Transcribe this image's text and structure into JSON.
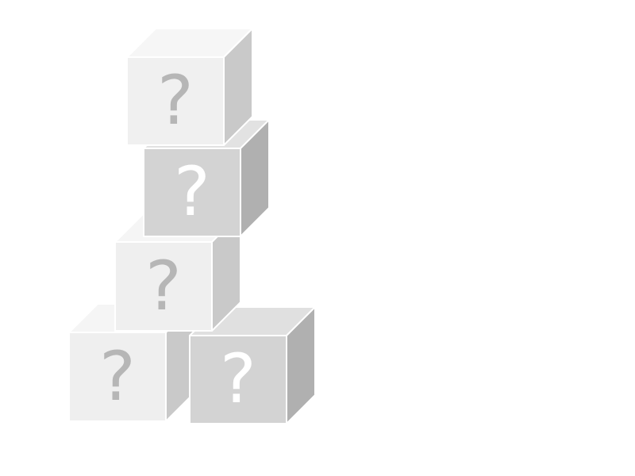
{
  "scene": {
    "background": "#ffffff",
    "cubes": [
      {
        "label": "?",
        "shade": "light",
        "colors": {
          "front": "#f0f0f0",
          "top": "#f6f6f6",
          "side": "#c9c9c9",
          "mark": "#b6b6b6"
        }
      },
      {
        "label": "?",
        "shade": "dark",
        "colors": {
          "front": "#d3d3d3",
          "top": "#e2e2e2",
          "side": "#b0b0b0",
          "mark": "#ffffff"
        }
      },
      {
        "label": "?",
        "shade": "light",
        "colors": {
          "front": "#efefef",
          "top": "#f5f5f5",
          "side": "#c9c9c9",
          "mark": "#b6b6b6"
        }
      },
      {
        "label": "?",
        "shade": "light",
        "colors": {
          "front": "#efefef",
          "top": "#f5f5f5",
          "side": "#c9c9c9",
          "mark": "#b6b6b6"
        }
      },
      {
        "label": "?",
        "shade": "dark",
        "colors": {
          "front": "#d3d3d3",
          "top": "#e0e0e0",
          "side": "#b0b0b0",
          "mark": "#ffffff"
        }
      }
    ]
  }
}
